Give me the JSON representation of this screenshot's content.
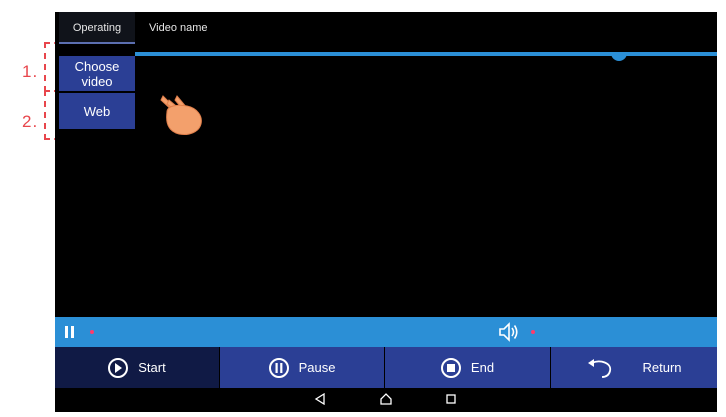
{
  "annotations": {
    "step1": "1.",
    "step2": "2."
  },
  "header": {
    "tabs": [
      {
        "label": "Operating"
      },
      {
        "label": "Video name"
      }
    ]
  },
  "menu": {
    "choose_video_line1": "Choose",
    "choose_video_line2": "video",
    "web": "Web"
  },
  "controls": {
    "start": "Start",
    "pause": "Pause",
    "end": "End",
    "return": "Return"
  },
  "icons": {
    "play": "play-circle-icon",
    "pause": "pause-circle-icon",
    "stop": "stop-circle-icon",
    "return": "return-arrow-icon",
    "volume": "volume-icon",
    "hand": "pointing-hand-icon"
  },
  "colors": {
    "accent_blue": "#2b8fd6",
    "button_blue": "#2b3f95",
    "button_active": "#101a45",
    "annotation_red": "#e8464c",
    "indicator_pink": "#ff3b6b"
  }
}
